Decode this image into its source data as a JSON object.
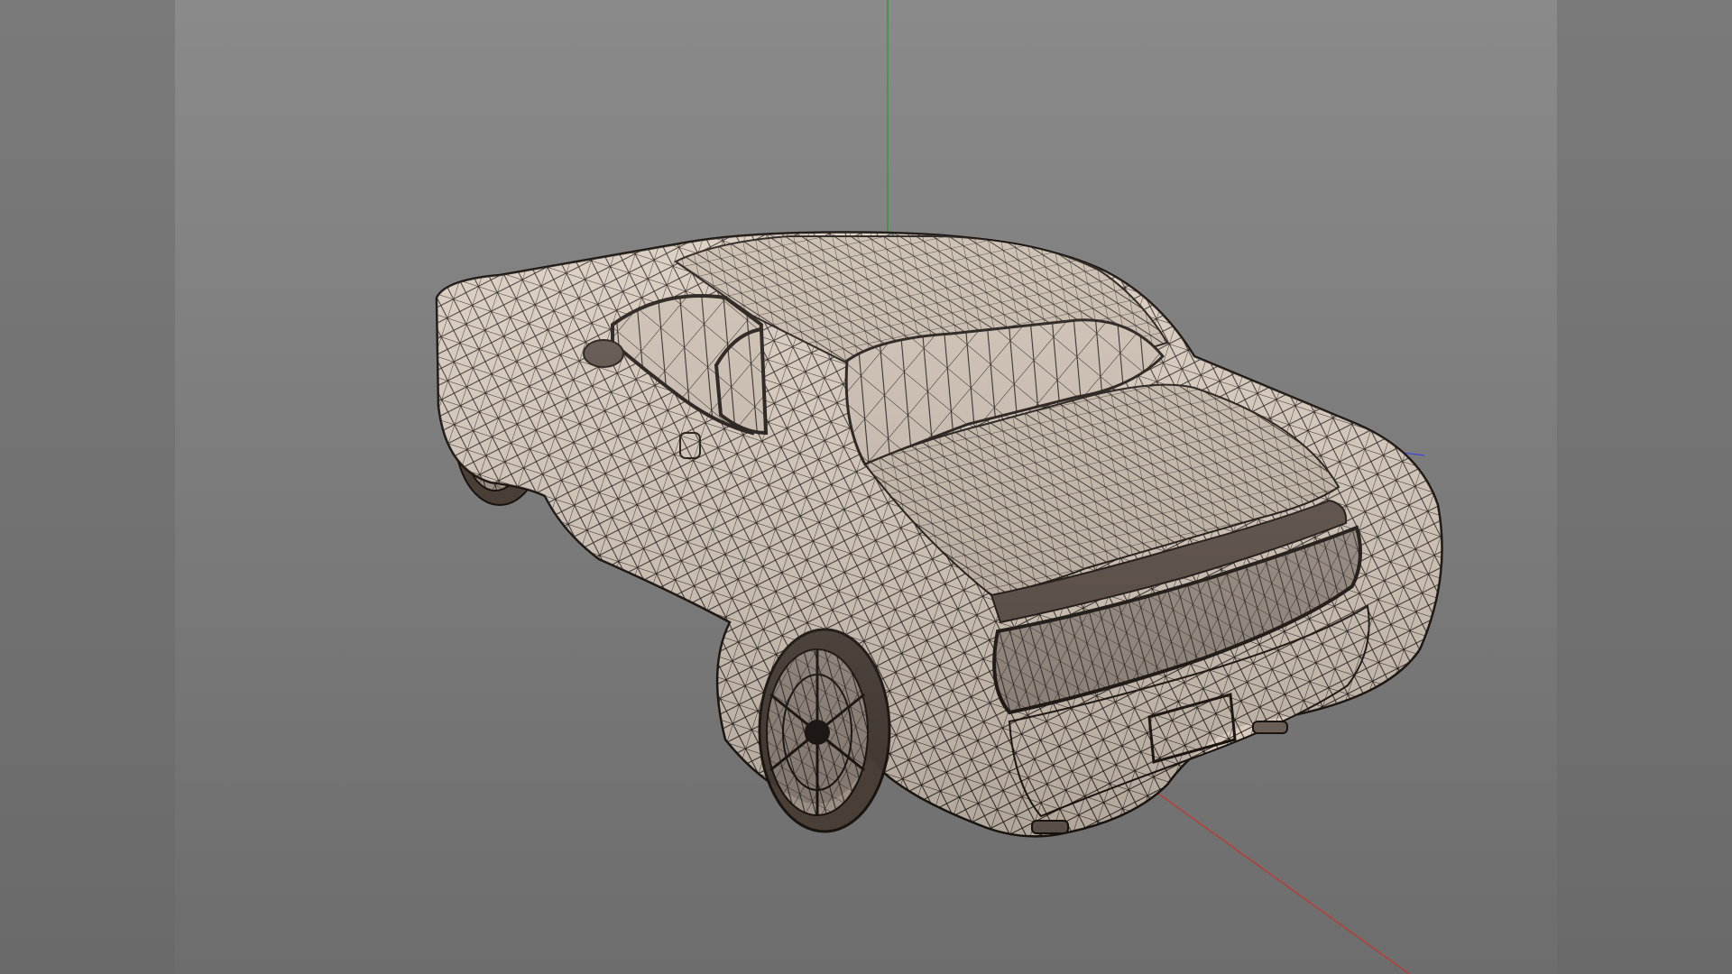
{
  "viewport": {
    "mode": "wireframe-shaded",
    "background_top": "#8a8a8a",
    "background_bottom": "#6d6d6d",
    "letterbox_color": "#707070"
  },
  "scene": {
    "object": "car-model",
    "surface_color": "#d9cbbd",
    "wire_color": "#1a1410",
    "axes": {
      "x_color": "#c8332c",
      "y_color": "#2f9a3a",
      "z_color": "#3a4ad0"
    }
  }
}
